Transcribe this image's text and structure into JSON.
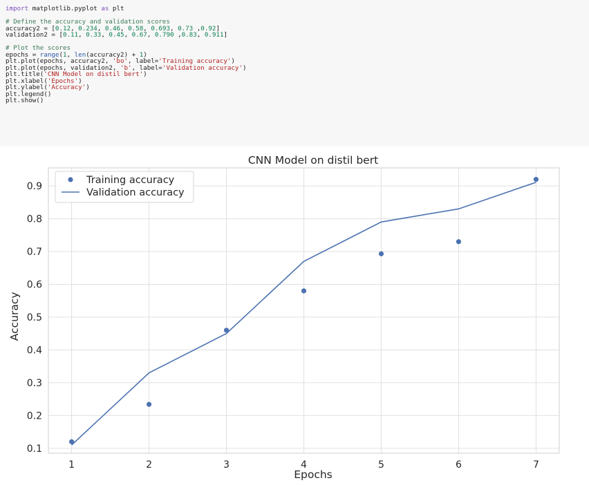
{
  "code": {
    "lines": [
      [
        {
          "t": "import",
          "c": "kw"
        },
        {
          "t": " matplotlib.pyplot ",
          "c": "plain"
        },
        {
          "t": "as",
          "c": "kw"
        },
        {
          "t": " plt",
          "c": "plain"
        }
      ],
      [],
      [
        {
          "t": "# Define the accuracy and validation scores",
          "c": "com"
        }
      ],
      [
        {
          "t": "accuracy2 = [",
          "c": "plain"
        },
        {
          "t": "0.12",
          "c": "num"
        },
        {
          "t": ", ",
          "c": "plain"
        },
        {
          "t": "0.234",
          "c": "num"
        },
        {
          "t": ", ",
          "c": "plain"
        },
        {
          "t": "0.46",
          "c": "num"
        },
        {
          "t": ", ",
          "c": "plain"
        },
        {
          "t": "0.58",
          "c": "num"
        },
        {
          "t": ", ",
          "c": "plain"
        },
        {
          "t": "0.693",
          "c": "num"
        },
        {
          "t": ", ",
          "c": "plain"
        },
        {
          "t": "0.73",
          "c": "num"
        },
        {
          "t": " ,",
          "c": "plain"
        },
        {
          "t": "0.92",
          "c": "num"
        },
        {
          "t": "]",
          "c": "plain"
        }
      ],
      [
        {
          "t": "validation2 = [",
          "c": "plain"
        },
        {
          "t": "0.11",
          "c": "num"
        },
        {
          "t": ", ",
          "c": "plain"
        },
        {
          "t": "0.33",
          "c": "num"
        },
        {
          "t": ", ",
          "c": "plain"
        },
        {
          "t": "0.45",
          "c": "num"
        },
        {
          "t": ", ",
          "c": "plain"
        },
        {
          "t": "0.67",
          "c": "num"
        },
        {
          "t": ", ",
          "c": "plain"
        },
        {
          "t": "0.790",
          "c": "num"
        },
        {
          "t": " ,",
          "c": "plain"
        },
        {
          "t": "0.83",
          "c": "num"
        },
        {
          "t": ", ",
          "c": "plain"
        },
        {
          "t": "0.911",
          "c": "num"
        },
        {
          "t": "]",
          "c": "plain"
        }
      ],
      [],
      [
        {
          "t": "# Plot the scores",
          "c": "com"
        }
      ],
      [
        {
          "t": "epochs = ",
          "c": "plain"
        },
        {
          "t": "range",
          "c": "fn"
        },
        {
          "t": "(",
          "c": "plain"
        },
        {
          "t": "1",
          "c": "num"
        },
        {
          "t": ", ",
          "c": "plain"
        },
        {
          "t": "len",
          "c": "fn"
        },
        {
          "t": "(accuracy2) + ",
          "c": "plain"
        },
        {
          "t": "1",
          "c": "num"
        },
        {
          "t": ")",
          "c": "plain"
        }
      ],
      [
        {
          "t": "plt.plot(epochs, accuracy2, ",
          "c": "plain"
        },
        {
          "t": "'bo'",
          "c": "str"
        },
        {
          "t": ", label=",
          "c": "plain"
        },
        {
          "t": "'Training accuracy'",
          "c": "str"
        },
        {
          "t": ")",
          "c": "plain"
        }
      ],
      [
        {
          "t": "plt.plot(epochs, validation2, ",
          "c": "plain"
        },
        {
          "t": "'b'",
          "c": "str"
        },
        {
          "t": ", label=",
          "c": "plain"
        },
        {
          "t": "'Validation accuracy'",
          "c": "str"
        },
        {
          "t": ")",
          "c": "plain"
        }
      ],
      [
        {
          "t": "plt.title(",
          "c": "plain"
        },
        {
          "t": "'CNN Model on distil bert'",
          "c": "str"
        },
        {
          "t": ")",
          "c": "plain"
        }
      ],
      [
        {
          "t": "plt.xlabel(",
          "c": "plain"
        },
        {
          "t": "'Epochs'",
          "c": "str"
        },
        {
          "t": ")",
          "c": "plain"
        }
      ],
      [
        {
          "t": "plt.ylabel(",
          "c": "plain"
        },
        {
          "t": "'Accuracy'",
          "c": "str"
        },
        {
          "t": ")",
          "c": "plain"
        }
      ],
      [
        {
          "t": "plt.legend()",
          "c": "plain"
        }
      ],
      [
        {
          "t": "plt.show()",
          "c": "plain"
        }
      ]
    ]
  },
  "chart_data": {
    "type": "line",
    "title": "CNN Model on distil bert",
    "xlabel": "Epochs",
    "ylabel": "Accuracy",
    "x": [
      1,
      2,
      3,
      4,
      5,
      6,
      7
    ],
    "xticks": [
      "1",
      "2",
      "3",
      "4",
      "5",
      "6",
      "7"
    ],
    "yticks": [
      "0.1",
      "0.2",
      "0.3",
      "0.4",
      "0.5",
      "0.6",
      "0.7",
      "0.8",
      "0.9"
    ],
    "xlim": [
      0.7,
      7.3
    ],
    "ylim": [
      0.085,
      0.955
    ],
    "grid": true,
    "legend_position": "upper-left",
    "series": [
      {
        "name": "Training accuracy",
        "style": "markers",
        "color": "#4c72b0",
        "values": [
          0.12,
          0.234,
          0.46,
          0.58,
          0.693,
          0.73,
          0.92
        ]
      },
      {
        "name": "Validation accuracy",
        "style": "line",
        "color": "#4c72b0",
        "values": [
          0.11,
          0.33,
          0.45,
          0.67,
          0.79,
          0.83,
          0.911
        ]
      }
    ]
  }
}
